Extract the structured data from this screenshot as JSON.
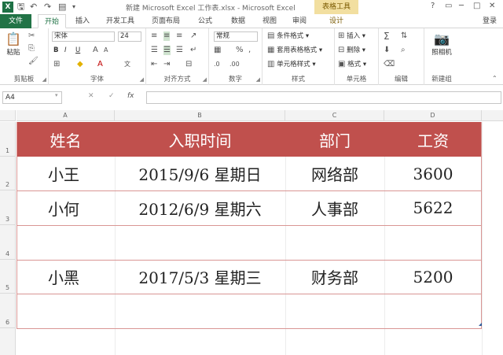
{
  "titlebar": {
    "title": "新建 Microsoft Excel 工作表.xlsx - Microsoft Excel",
    "context_tab": "表格工具",
    "window_buttons": [
      "?",
      "▭",
      "─",
      "□",
      "✕"
    ]
  },
  "tabs": {
    "file": "文件",
    "items": [
      "开始",
      "插入",
      "开发工具",
      "页面布局",
      "公式",
      "数据",
      "视图",
      "审阅",
      "设计"
    ],
    "login": "登录"
  },
  "ribbon": {
    "clipboard": {
      "label": "剪贴板",
      "paste": "粘贴"
    },
    "font": {
      "label": "字体",
      "name": "宋体",
      "size": "24",
      "bold": "B",
      "italic": "I",
      "underline": "U"
    },
    "alignment": {
      "label": "对齐方式"
    },
    "number": {
      "label": "数字",
      "format": "常规"
    },
    "styles": {
      "label": "样式",
      "conditional": "条件格式",
      "table_format": "套用表格格式",
      "cell_styles": "单元格样式"
    },
    "cells": {
      "label": "单元格",
      "insert": "插入",
      "delete": "删除",
      "format": "格式"
    },
    "editing": {
      "label": "编辑"
    },
    "new_group": {
      "label": "新建组",
      "camera": "照相机"
    }
  },
  "formula_bar": {
    "name_box": "A4",
    "fx": "fx",
    "value": ""
  },
  "sheet": {
    "columns": [
      "A",
      "B",
      "C",
      "D"
    ],
    "rows": [
      "1",
      "2",
      "3",
      "4",
      "5",
      "6"
    ],
    "header": [
      "姓名",
      "入职时间",
      "部门",
      "工资"
    ],
    "data": [
      [
        "小王",
        "2015/9/6  星期日",
        "网络部",
        "3600"
      ],
      [
        "小何",
        "2012/6/9  星期六",
        "人事部",
        "5622"
      ],
      [
        "",
        "",
        "",
        ""
      ],
      [
        "小黑",
        "2017/5/3  星期三",
        "财务部",
        "5200"
      ],
      [
        "",
        "",
        "",
        ""
      ]
    ],
    "header_color": "#c0504d",
    "border_color": "#d99694"
  }
}
